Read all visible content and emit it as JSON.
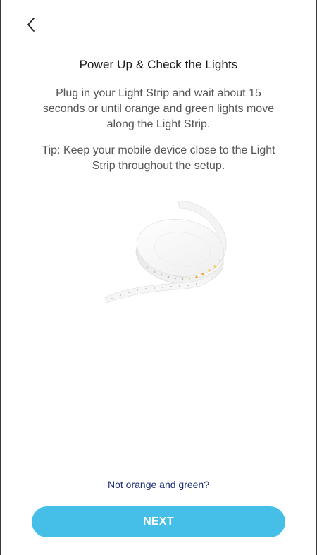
{
  "header": {
    "back_icon": "chevron-left-icon"
  },
  "content": {
    "title": "Power Up & Check the Lights",
    "instruction": "Plug in your Light Strip and wait about 15 seconds or until orange and green lights move along the Light Strip.",
    "tip": "Tip: Keep your mobile device close to the Light Strip throughout the setup.",
    "illustration": "light-strip-reel-image"
  },
  "footer": {
    "help_link": "Not orange and green?",
    "next_label": "NEXT"
  },
  "colors": {
    "accent": "#45bfe8",
    "link": "#1e2f7a",
    "led_orange": "#f5a623",
    "led_yellow": "#f6d04d"
  }
}
